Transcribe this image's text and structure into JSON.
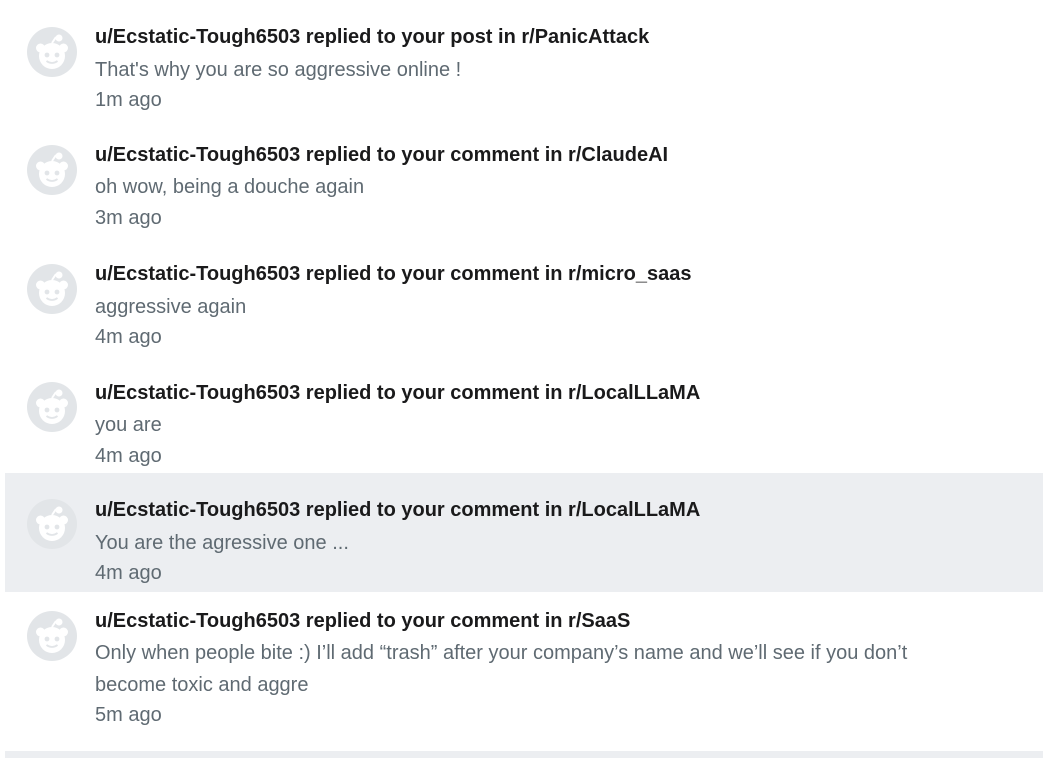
{
  "notifications": [
    {
      "title": "u/Ecstatic-Tough6503 replied to your post in r/PanicAttack",
      "body": "That's why you are so aggressive online !",
      "time": "1m ago"
    },
    {
      "title": "u/Ecstatic-Tough6503 replied to your comment in r/ClaudeAI",
      "body": "oh wow, being a douche again",
      "time": "3m ago"
    },
    {
      "title": "u/Ecstatic-Tough6503 replied to your comment in r/micro_saas",
      "body": "aggressive again",
      "time": "4m ago"
    },
    {
      "title": "u/Ecstatic-Tough6503 replied to your comment in r/LocalLLaMA",
      "body": "you are",
      "time": "4m ago"
    },
    {
      "title": "u/Ecstatic-Tough6503 replied to your comment in r/LocalLLaMA",
      "body": "You are the agressive one ...",
      "time": "4m ago"
    },
    {
      "title": "u/Ecstatic-Tough6503 replied to your comment in r/SaaS",
      "body": "Only when people bite :) I’ll add “trash” after your company’s name and we’ll see if you don’t become toxic and aggre",
      "time": "5m ago"
    }
  ],
  "colors": {
    "highlight_background": "#eceef1",
    "avatar_gray": "#e2e5e8",
    "title_text": "#1a1a1b",
    "secondary_text": "#5f6a72"
  },
  "icons": {
    "avatar": "default-snoo-avatar-icon"
  }
}
